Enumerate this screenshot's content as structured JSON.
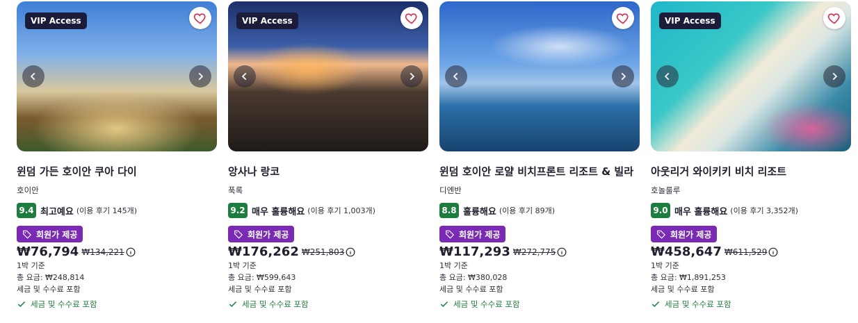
{
  "cards": [
    {
      "badge": "VIP Access",
      "name": "윈덤 가든 호이안 쿠아 다이",
      "location": "호이안",
      "score": "9.4",
      "rating_text": "최고예요",
      "review_count": "(이용 후기 145개)",
      "member_label": "회원가 제공",
      "price": "₩76,794",
      "original_price": "₩134,221",
      "per_night": "1박 기준",
      "total": "총 요금: ₩248,814",
      "tax_note": "세금 및 수수료 포함",
      "tax_included": "세금 및 수수료 포함",
      "image": "resort-garden-photo"
    },
    {
      "badge": "VIP Access",
      "name": "앙사나 랑코",
      "location": "푹록",
      "score": "9.2",
      "rating_text": "매우 훌륭해요",
      "review_count": "(이용 후기 1,003개)",
      "member_label": "회원가 제공",
      "price": "₩176,262",
      "original_price": "₩251,803",
      "per_night": "1박 기준",
      "total": "총 요금: ₩599,643",
      "tax_note": "세금 및 수수료 포함",
      "tax_included": "세금 및 수수료 포함",
      "image": "dusk-restaurant-photo"
    },
    {
      "badge": "",
      "name": "윈덤 호이안 로얄 비치프론트 리조트 & 빌라",
      "location": "디엔반",
      "score": "8.8",
      "rating_text": "훌륭해요",
      "review_count": "(이용 후기 89개)",
      "member_label": "회원가 제공",
      "price": "₩117,293",
      "original_price": "₩272,775",
      "per_night": "1박 기준",
      "total": "총 요금: ₩380,028",
      "tax_note": "세금 및 수수료 포함",
      "tax_included": "세금 및 수수료 포함",
      "image": "infinity-pool-photo"
    },
    {
      "badge": "VIP Access",
      "name": "아웃리거 와이키키 비치 리조트",
      "location": "호놀룰루",
      "score": "9.0",
      "rating_text": "매우 훌륭해요",
      "review_count": "(이용 후기 3,352개)",
      "member_label": "회원가 제공",
      "price": "₩458,647",
      "original_price": "₩611,529",
      "per_night": "1박 기준",
      "total": "총 요금: ₩1,891,253",
      "tax_note": "세금 및 수수료 포함",
      "tax_included": "세금 및 수수료 포함",
      "image": "aerial-beach-photo"
    }
  ],
  "colors": {
    "score_green": "#1e7d3e",
    "member_purple": "#7a2ab5",
    "badge_navy": "#1a1c3a",
    "heart_red": "#d32f4e"
  }
}
